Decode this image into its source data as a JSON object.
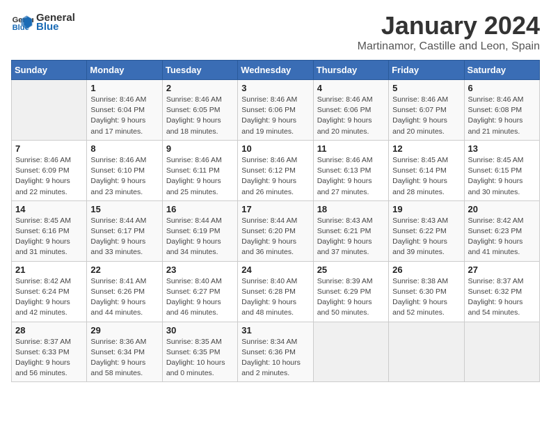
{
  "logo": {
    "general": "General",
    "blue": "Blue"
  },
  "title": "January 2024",
  "location": "Martinamor, Castille and Leon, Spain",
  "days_header": [
    "Sunday",
    "Monday",
    "Tuesday",
    "Wednesday",
    "Thursday",
    "Friday",
    "Saturday"
  ],
  "weeks": [
    [
      {
        "day": "",
        "info": ""
      },
      {
        "day": "1",
        "info": "Sunrise: 8:46 AM\nSunset: 6:04 PM\nDaylight: 9 hours\nand 17 minutes."
      },
      {
        "day": "2",
        "info": "Sunrise: 8:46 AM\nSunset: 6:05 PM\nDaylight: 9 hours\nand 18 minutes."
      },
      {
        "day": "3",
        "info": "Sunrise: 8:46 AM\nSunset: 6:06 PM\nDaylight: 9 hours\nand 19 minutes."
      },
      {
        "day": "4",
        "info": "Sunrise: 8:46 AM\nSunset: 6:06 PM\nDaylight: 9 hours\nand 20 minutes."
      },
      {
        "day": "5",
        "info": "Sunrise: 8:46 AM\nSunset: 6:07 PM\nDaylight: 9 hours\nand 20 minutes."
      },
      {
        "day": "6",
        "info": "Sunrise: 8:46 AM\nSunset: 6:08 PM\nDaylight: 9 hours\nand 21 minutes."
      }
    ],
    [
      {
        "day": "7",
        "info": ""
      },
      {
        "day": "8",
        "info": "Sunrise: 8:46 AM\nSunset: 6:10 PM\nDaylight: 9 hours\nand 23 minutes."
      },
      {
        "day": "9",
        "info": "Sunrise: 8:46 AM\nSunset: 6:11 PM\nDaylight: 9 hours\nand 25 minutes."
      },
      {
        "day": "10",
        "info": "Sunrise: 8:46 AM\nSunset: 6:12 PM\nDaylight: 9 hours\nand 26 minutes."
      },
      {
        "day": "11",
        "info": "Sunrise: 8:46 AM\nSunset: 6:13 PM\nDaylight: 9 hours\nand 27 minutes."
      },
      {
        "day": "12",
        "info": "Sunrise: 8:45 AM\nSunset: 6:14 PM\nDaylight: 9 hours\nand 28 minutes."
      },
      {
        "day": "13",
        "info": "Sunrise: 8:45 AM\nSunset: 6:15 PM\nDaylight: 9 hours\nand 30 minutes."
      }
    ],
    [
      {
        "day": "14",
        "info": ""
      },
      {
        "day": "15",
        "info": "Sunrise: 8:44 AM\nSunset: 6:17 PM\nDaylight: 9 hours\nand 33 minutes."
      },
      {
        "day": "16",
        "info": "Sunrise: 8:44 AM\nSunset: 6:19 PM\nDaylight: 9 hours\nand 34 minutes."
      },
      {
        "day": "17",
        "info": "Sunrise: 8:44 AM\nSunset: 6:20 PM\nDaylight: 9 hours\nand 36 minutes."
      },
      {
        "day": "18",
        "info": "Sunrise: 8:43 AM\nSunset: 6:21 PM\nDaylight: 9 hours\nand 37 minutes."
      },
      {
        "day": "19",
        "info": "Sunrise: 8:43 AM\nSunset: 6:22 PM\nDaylight: 9 hours\nand 39 minutes."
      },
      {
        "day": "20",
        "info": "Sunrise: 8:42 AM\nSunset: 6:23 PM\nDaylight: 9 hours\nand 41 minutes."
      }
    ],
    [
      {
        "day": "21",
        "info": ""
      },
      {
        "day": "22",
        "info": "Sunrise: 8:41 AM\nSunset: 6:26 PM\nDaylight: 9 hours\nand 44 minutes."
      },
      {
        "day": "23",
        "info": "Sunrise: 8:40 AM\nSunset: 6:27 PM\nDaylight: 9 hours\nand 46 minutes."
      },
      {
        "day": "24",
        "info": "Sunrise: 8:40 AM\nSunset: 6:28 PM\nDaylight: 9 hours\nand 48 minutes."
      },
      {
        "day": "25",
        "info": "Sunrise: 8:39 AM\nSunset: 6:29 PM\nDaylight: 9 hours\nand 50 minutes."
      },
      {
        "day": "26",
        "info": "Sunrise: 8:38 AM\nSunset: 6:30 PM\nDaylight: 9 hours\nand 52 minutes."
      },
      {
        "day": "27",
        "info": "Sunrise: 8:37 AM\nSunset: 6:32 PM\nDaylight: 9 hours\nand 54 minutes."
      }
    ],
    [
      {
        "day": "28",
        "info": "Sunrise: 8:37 AM\nSunset: 6:33 PM\nDaylight: 9 hours\nand 56 minutes."
      },
      {
        "day": "29",
        "info": "Sunrise: 8:36 AM\nSunset: 6:34 PM\nDaylight: 9 hours\nand 58 minutes."
      },
      {
        "day": "30",
        "info": "Sunrise: 8:35 AM\nSunset: 6:35 PM\nDaylight: 10 hours\nand 0 minutes."
      },
      {
        "day": "31",
        "info": "Sunrise: 8:34 AM\nSunset: 6:36 PM\nDaylight: 10 hours\nand 2 minutes."
      },
      {
        "day": "",
        "info": ""
      },
      {
        "day": "",
        "info": ""
      },
      {
        "day": "",
        "info": ""
      }
    ]
  ],
  "week1_sun_info": "Sunrise: 8:46 AM\nSunset: 6:09 PM\nDaylight: 9 hours\nand 22 minutes.",
  "week3_sun_info": "Sunrise: 8:45 AM\nSunset: 6:16 PM\nDaylight: 9 hours\nand 31 minutes.",
  "week4_sun_info": "Sunrise: 8:42 AM\nSunset: 6:24 PM\nDaylight: 9 hours\nand 42 minutes.",
  "week5_sun_info": "Sunrise: 8:42 AM\nSunset: 6:24 PM\nDaylight: 9 hours\nand 42 minutes."
}
